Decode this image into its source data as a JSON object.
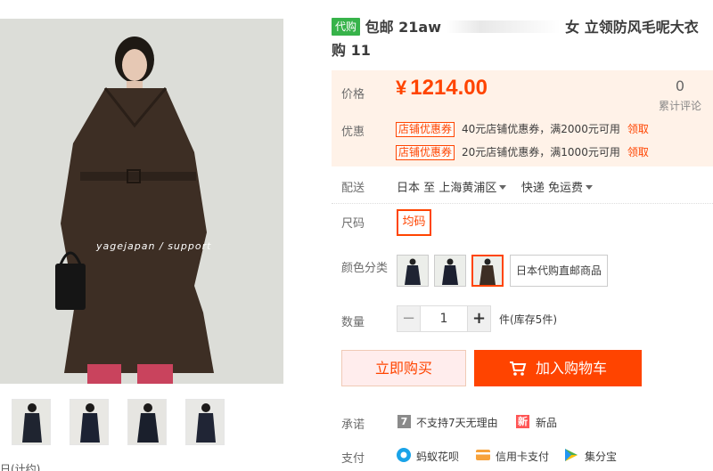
{
  "gallery": {
    "watermark": "yagejapan / support",
    "caption_fragment": "日(计约)"
  },
  "title": {
    "badge": "代购",
    "text_line1": "包邮 21aw",
    "text_line1_end": "女 立领防风毛呢大衣",
    "text_line2": "购 11"
  },
  "price_panel": {
    "price_label": "价格",
    "currency": "¥",
    "price": "1214.00",
    "review_count": "0",
    "review_label": "累计评论",
    "promo_label": "优惠",
    "coupons": [
      {
        "tag": "店铺优惠券",
        "text": "40元店铺优惠券，满2000元可用",
        "action": "领取"
      },
      {
        "tag": "店铺优惠券",
        "text": "20元店铺优惠券，满1000元可用",
        "action": "领取"
      }
    ]
  },
  "shipping": {
    "label": "配送",
    "origin": "日本",
    "to": "至",
    "destination": "上海黄浦区",
    "method": "快递 免运费"
  },
  "size": {
    "label": "尺码",
    "option": "均码"
  },
  "color": {
    "label": "颜色分类",
    "text_option": "日本代购直邮商品"
  },
  "quantity": {
    "label": "数量",
    "minus": "−",
    "value": "1",
    "plus": "+",
    "stock": "件(库存5件)"
  },
  "actions": {
    "buy_now": "立即购买",
    "add_to_cart": "加入购物车"
  },
  "promise": {
    "label": "承诺",
    "no_return_icon": "7",
    "no_return": "不支持7天无理由",
    "new_icon": "新",
    "new_item": "新品"
  },
  "payment": {
    "label": "支付",
    "methods": [
      "蚂蚁花呗",
      "信用卡支付",
      "集分宝"
    ]
  },
  "colors": {
    "accent": "#ff4400",
    "price_bg": "#fff2e8",
    "badge_green": "#37b34a"
  }
}
